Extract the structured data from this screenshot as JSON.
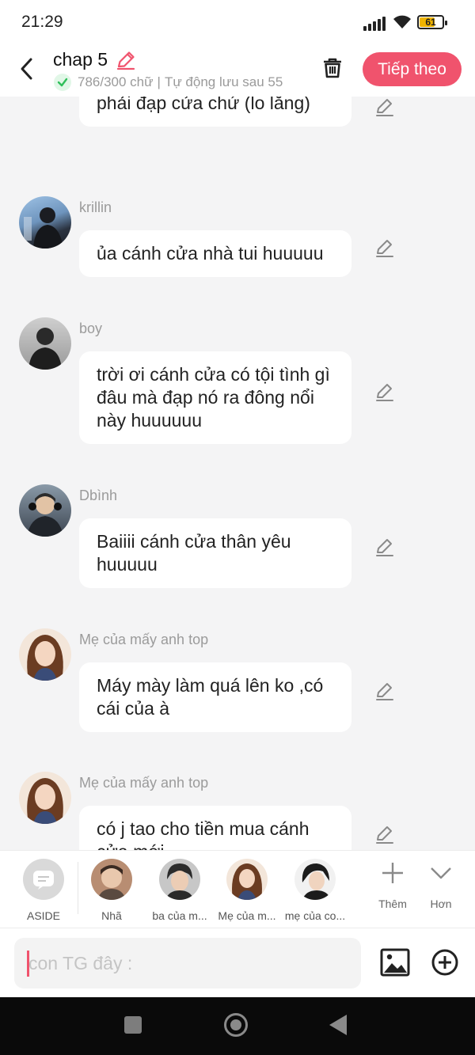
{
  "status_bar": {
    "time": "21:29",
    "battery_level": "61"
  },
  "header": {
    "title": "chap 5",
    "word_count": "786/300 chữ",
    "separator": "|",
    "autosave_text": "Tự động lưu sau 55",
    "next_button": "Tiếp theo"
  },
  "messages": [
    {
      "author": "",
      "text": "trời ơi cánh cửa có tội gì, sao phải đạp cửa chứ (lo lắng)",
      "avatar_icon": ""
    },
    {
      "author": "krillin",
      "text": "ủa cánh cửa nhà tui huuuuu",
      "avatar_icon": "user-avatar-krillin"
    },
    {
      "author": "boy",
      "text": "trời ơi cánh cửa có tội tình gì đâu mà đạp nó ra đông nổi này huuuuuu",
      "avatar_icon": "user-avatar-boy"
    },
    {
      "author": "Dbình",
      "text": "Baiiii cánh cửa thân yêu huuuuu",
      "avatar_icon": "user-avatar-dbinh"
    },
    {
      "author": "Mẹ của mấy anh top",
      "text": "Máy mày làm quá lên ko ,có cái của à",
      "avatar_icon": "user-avatar-me"
    },
    {
      "author": "Mẹ của mấy anh top",
      "text": "có j tao cho tiền mua cánh cửa mới",
      "avatar_icon": "user-avatar-me"
    }
  ],
  "characters": [
    {
      "label": "ASIDE",
      "icon": "aside-icon"
    },
    {
      "label": "Nhã",
      "icon": "character-avatar"
    },
    {
      "label": "ba của m...",
      "icon": "character-avatar"
    },
    {
      "label": "Mẹ của m...",
      "icon": "character-avatar"
    },
    {
      "label": "mẹ của co...",
      "icon": "character-avatar"
    }
  ],
  "tools": {
    "add_label": "Thêm",
    "more_label": "Hơn"
  },
  "composer": {
    "placeholder": "con TG đây :"
  },
  "colors": {
    "accent": "#f0536d",
    "background": "#f4f4f5",
    "bubble": "#ffffff",
    "check_green": "#2fbf5a"
  }
}
